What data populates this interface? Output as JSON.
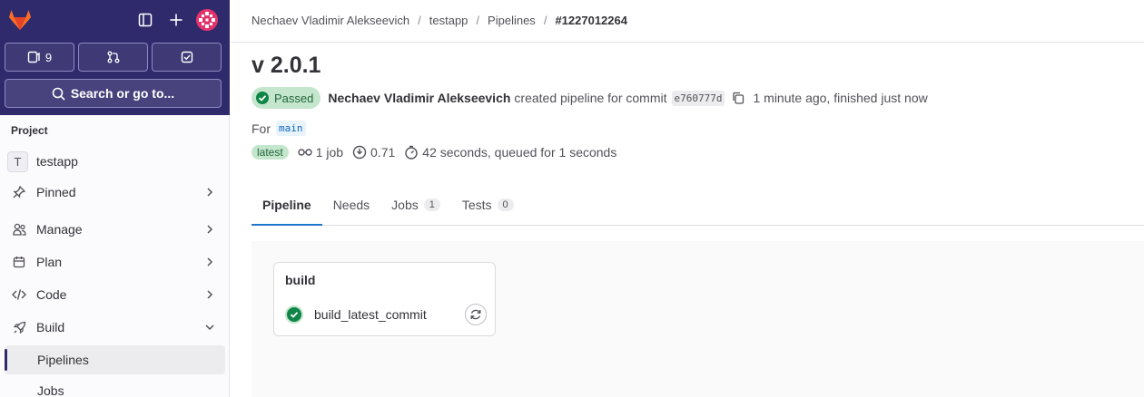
{
  "sidebar": {
    "counters": [
      {
        "icon": "issues-icon",
        "count": "9"
      },
      {
        "icon": "merge-request-icon",
        "count": ""
      },
      {
        "icon": "todo-icon",
        "count": ""
      }
    ],
    "search_label": "Search or go to...",
    "section_label": "Project",
    "project": {
      "avatar_letter": "T",
      "name": "testapp"
    },
    "nav": [
      {
        "label": "Pinned",
        "icon": "pin-icon"
      },
      {
        "label": "Manage",
        "icon": "users-icon"
      },
      {
        "label": "Plan",
        "icon": "calendar-icon"
      },
      {
        "label": "Code",
        "icon": "code-icon"
      },
      {
        "label": "Build",
        "icon": "rocket-icon"
      }
    ],
    "sub_items": [
      {
        "label": "Pipelines",
        "active": true
      },
      {
        "label": "Jobs",
        "active": false
      }
    ]
  },
  "breadcrumb": {
    "items": [
      "Nechaev Vladimir Alekseevich",
      "testapp",
      "Pipelines"
    ],
    "current": "#1227012264"
  },
  "pipeline": {
    "title": "v 2.0.1",
    "status": "Passed",
    "author": "Nechaev Vladimir Alekseevich",
    "action_text": "created pipeline for commit",
    "commit_sha": "e760777d",
    "time_text": "1 minute ago, finished just now",
    "for_label": "For",
    "branch": "main",
    "latest_badge": "latest",
    "jobs_count": "1 job",
    "coverage": "0.71",
    "duration": "42 seconds, queued for 1 seconds"
  },
  "tabs": [
    {
      "label": "Pipeline",
      "count": null,
      "active": true
    },
    {
      "label": "Needs",
      "count": null,
      "active": false
    },
    {
      "label": "Jobs",
      "count": "1",
      "active": false
    },
    {
      "label": "Tests",
      "count": "0",
      "active": false
    }
  ],
  "graph": {
    "stage": "build",
    "job": "build_latest_commit",
    "job_status": "success"
  },
  "colors": {
    "sidebar_top": "#2f2a6b",
    "success": "#108548",
    "success_bg": "#c3e6cd",
    "active_tab": "#1f75cb"
  }
}
